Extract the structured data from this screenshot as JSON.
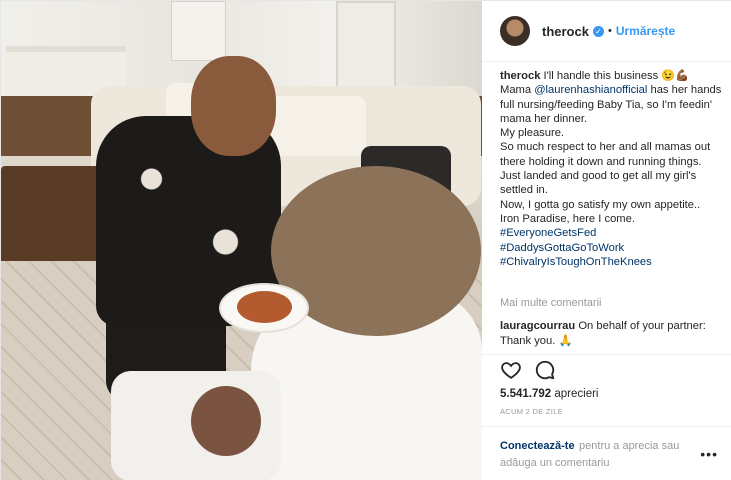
{
  "header": {
    "username": "therock",
    "verified_glyph": "✓",
    "separator": "•",
    "follow_label": "Urmărește"
  },
  "caption": {
    "username": "therock",
    "lines": [
      "I'll handle this business 😉💪🏾",
      "Mama",
      "@laurenhashianofficial",
      "has her hands full nursing/feeding Baby Tia, so I'm feedin' mama her dinner.",
      "My pleasure.",
      "So much respect to her and all mamas out there holding it down and running things.",
      "Just landed and good to get all my girl's settled in.",
      "Now, I gotta go satisfy my own appetite..",
      "Iron Paradise, here I come."
    ],
    "hashtags": [
      "#EveryoneGetsFed",
      "#DaddysGottaGoToWork",
      "#ChivalryIsToughOnTheKnees"
    ]
  },
  "more_comments_label": "Mai multe comentarii",
  "comment": {
    "username": "lauragcourrau",
    "text": "On behalf of your partner: Thank you. 🙏"
  },
  "actions": {
    "like_icon": "heart-outline-icon",
    "comment_icon": "comment-bubble-icon"
  },
  "likes": {
    "count": "5.541.792",
    "label": "aprecieri"
  },
  "timestamp": "ACUM 2 DE ZILE",
  "add_comment": {
    "login_label": "Conectează-te",
    "rest_label": "pentru a aprecia sau adăuga un comentariu",
    "menu_glyph": "•••"
  },
  "colors": {
    "accent": "#3897f0",
    "link": "#003569",
    "muted": "#999999"
  }
}
